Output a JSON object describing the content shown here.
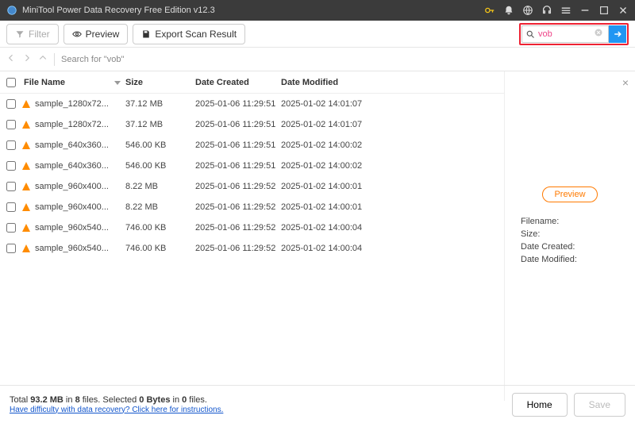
{
  "titlebar": {
    "title": "MiniTool Power Data Recovery Free Edition v12.3"
  },
  "toolbar": {
    "filter_label": "Filter",
    "preview_label": "Preview",
    "export_label": "Export Scan Result"
  },
  "search": {
    "value": "vob"
  },
  "nav": {
    "breadcrumb": "Search for  \"vob\""
  },
  "columns": {
    "name": "File Name",
    "size": "Size",
    "created": "Date Created",
    "modified": "Date Modified"
  },
  "rows": [
    {
      "name": "sample_1280x72...",
      "size": "37.12 MB",
      "created": "2025-01-06 11:29:51",
      "modified": "2025-01-02 14:01:07"
    },
    {
      "name": "sample_1280x72...",
      "size": "37.12 MB",
      "created": "2025-01-06 11:29:51",
      "modified": "2025-01-02 14:01:07"
    },
    {
      "name": "sample_640x360...",
      "size": "546.00 KB",
      "created": "2025-01-06 11:29:51",
      "modified": "2025-01-02 14:00:02"
    },
    {
      "name": "sample_640x360...",
      "size": "546.00 KB",
      "created": "2025-01-06 11:29:51",
      "modified": "2025-01-02 14:00:02"
    },
    {
      "name": "sample_960x400...",
      "size": "8.22 MB",
      "created": "2025-01-06 11:29:52",
      "modified": "2025-01-02 14:00:01"
    },
    {
      "name": "sample_960x400...",
      "size": "8.22 MB",
      "created": "2025-01-06 11:29:52",
      "modified": "2025-01-02 14:00:01"
    },
    {
      "name": "sample_960x540...",
      "size": "746.00 KB",
      "created": "2025-01-06 11:29:52",
      "modified": "2025-01-02 14:00:04"
    },
    {
      "name": "sample_960x540...",
      "size": "746.00 KB",
      "created": "2025-01-06 11:29:52",
      "modified": "2025-01-02 14:00:04"
    }
  ],
  "side": {
    "preview_btn": "Preview",
    "filename_label": "Filename:",
    "size_label": "Size:",
    "created_label": "Date Created:",
    "modified_label": "Date Modified:"
  },
  "footer": {
    "total_prefix": "Total ",
    "total_size": "93.2 MB",
    "in_files": " in ",
    "file_count": "8",
    "files_word": " files. ",
    "selected_prefix": " Selected ",
    "selected_size": "0 Bytes",
    "selected_in": " in ",
    "selected_count": "0",
    "selected_files": " files.",
    "help_link": "Have difficulty with data recovery? Click here for instructions.",
    "home_btn": "Home",
    "save_btn": "Save"
  }
}
